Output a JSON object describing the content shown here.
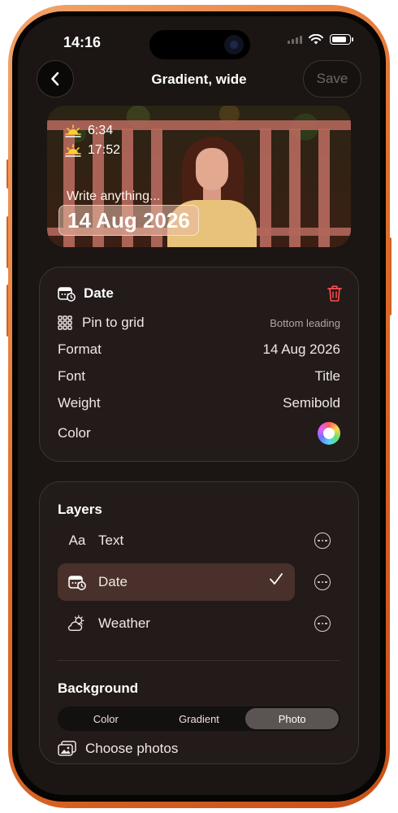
{
  "status_bar": {
    "time": "14:16"
  },
  "nav": {
    "title": "Gradient, wide",
    "save_label": "Save"
  },
  "preview": {
    "sunrise": "6:34",
    "sunset": "17:52",
    "text_placeholder": "Write anything...",
    "date_text": "14 Aug 2026"
  },
  "date_card": {
    "title": "Date",
    "rows": [
      {
        "label": "Pin to grid",
        "value": "Bottom leading"
      },
      {
        "label": "Format",
        "value": "14 Aug 2026"
      },
      {
        "label": "Font",
        "value": "Title"
      },
      {
        "label": "Weight",
        "value": "Semibold"
      },
      {
        "label": "Color",
        "value": ""
      }
    ]
  },
  "layers": {
    "title": "Layers",
    "items": [
      {
        "icon": "Aa",
        "label": "Text",
        "selected": false
      },
      {
        "icon": "calendar-clock-icon",
        "label": "Date",
        "selected": true
      },
      {
        "icon": "cloud-sun-icon",
        "label": "Weather",
        "selected": false
      }
    ]
  },
  "background": {
    "title": "Background",
    "options": [
      "Color",
      "Gradient",
      "Photo"
    ],
    "selected": "Photo",
    "choose_label": "Choose photos"
  },
  "colors": {
    "accent_delete": "#ff4d4d",
    "frame": "#e26f2c",
    "selected_row": "#4a302a"
  }
}
